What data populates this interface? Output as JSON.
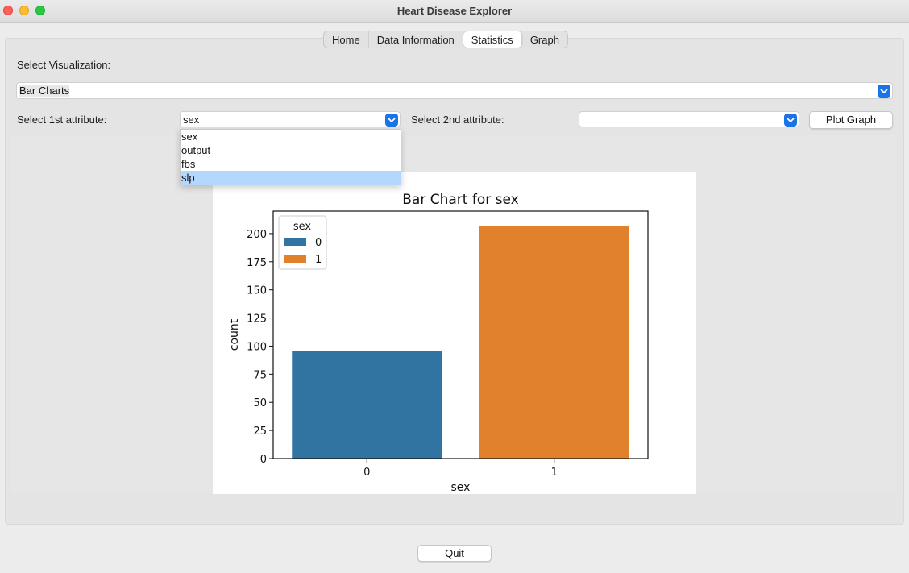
{
  "window": {
    "title": "Heart Disease Explorer"
  },
  "tabs": [
    {
      "label": "Home",
      "active": false
    },
    {
      "label": "Data Information",
      "active": false
    },
    {
      "label": "Statistics",
      "active": true
    },
    {
      "label": "Graph",
      "active": false
    }
  ],
  "controls": {
    "visualization_label": "Select Visualization:",
    "visualization_value": "Bar Charts",
    "attr1_label": "Select 1st attribute:",
    "attr1_value": "sex",
    "attr2_label": "Select 2nd attribute:",
    "attr2_value": "",
    "plot_button": "Plot Graph",
    "quit_button": "Quit"
  },
  "dropdown": {
    "options": [
      "sex",
      "output",
      "fbs",
      "slp"
    ],
    "highlighted": "slp"
  },
  "colors": {
    "accent": "#1a73e8",
    "series0": "#3274a1",
    "series1": "#e1812c"
  },
  "chart_data": {
    "type": "bar",
    "title": "Bar Chart for sex",
    "xlabel": "sex",
    "ylabel": "count",
    "categories": [
      "0",
      "1"
    ],
    "values": [
      96,
      207
    ],
    "ylim": [
      0,
      220
    ],
    "yticks": [
      0,
      25,
      50,
      75,
      100,
      125,
      150,
      175,
      200
    ],
    "legend": {
      "title": "sex",
      "position": "top-left",
      "entries": [
        {
          "label": "0",
          "color": "#3274a1"
        },
        {
          "label": "1",
          "color": "#e1812c"
        }
      ]
    },
    "grid": false
  }
}
